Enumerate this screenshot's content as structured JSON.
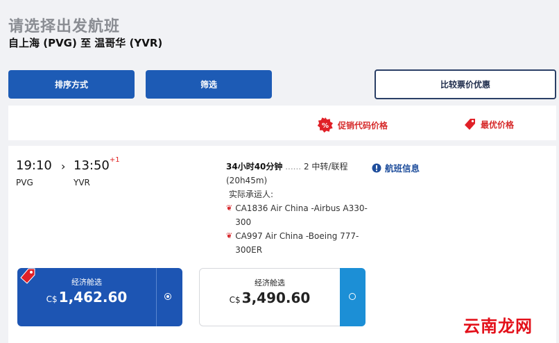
{
  "header": {
    "title": "请选择出发航班",
    "route": "自上海 (PVG) 至 温哥华 (YVR)"
  },
  "toolbar": {
    "sort_label": "排序方式",
    "filter_label": "筛选",
    "compare_label": "比较票价优惠"
  },
  "price_legend": {
    "promo_label": "促销代码价格",
    "best_label": "最优价格"
  },
  "flight": {
    "depart_time": "19:10",
    "arrive_time": "13:50",
    "day_offset": "+1",
    "origin_code": "PVG",
    "dest_code": "YVR",
    "duration": "34小时40分钟",
    "stops": "2 中转/联程",
    "alt_duration": "(20h45m)",
    "operator_label": "实际承运人:",
    "legs": [
      {
        "flight": "CA1836 Air China -Airbus A330-300"
      },
      {
        "flight": "CA997 Air China -Boeing 777-300ER"
      }
    ],
    "info_label": "航班信息"
  },
  "fares": {
    "economy": {
      "label": "经济舱选",
      "currency": "C$",
      "price": "1,462.60"
    },
    "premium": {
      "label": "经济舱选",
      "currency": "C$",
      "price": "3,490.60"
    }
  },
  "watermark": "云南龙网",
  "colors": {
    "primary": "#1d5bb5",
    "accent_red": "#d62a2a",
    "badge": "#e02027"
  }
}
